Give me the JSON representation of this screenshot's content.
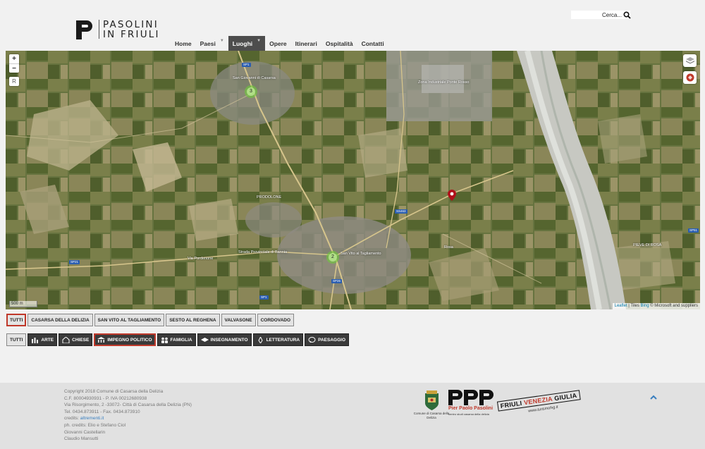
{
  "header": {
    "logo_line1": "PASOLINI",
    "logo_line2": "IN FRIULI",
    "search_placeholder": "Cerca...",
    "nav": [
      {
        "label": "Home",
        "has_caret": false,
        "active": false
      },
      {
        "label": "Paesi",
        "has_caret": true,
        "active": false
      },
      {
        "label": "Luoghi",
        "has_caret": true,
        "active": true
      },
      {
        "label": "Opere",
        "has_caret": false,
        "active": false
      },
      {
        "label": "Itinerari",
        "has_caret": false,
        "active": false
      },
      {
        "label": "Ospitalità",
        "has_caret": false,
        "active": false
      },
      {
        "label": "Contatti",
        "has_caret": false,
        "active": false
      }
    ]
  },
  "map": {
    "zoom_in": "+",
    "zoom_out": "−",
    "reset": "R",
    "clusters": [
      "3",
      "2"
    ],
    "labels": {
      "prodolone": "PRODOLONE",
      "san_giovanni": "San Giovanni di Casarsa",
      "san_vito": "San Vito al Tagliamento",
      "zona_industriale": "Zona Industriale Ponte Rosso",
      "pieve_di_rosa": "PIEVE DI ROSA",
      "via_pordenone": "Via Pordenone",
      "strada_provinciale": "Strada Provinciale di Bannia",
      "rosa": "Rosa"
    },
    "road_shields": [
      "SP1",
      "SP21",
      "SS463",
      "SP26",
      "SP1",
      "SP51"
    ],
    "scale": "500 m",
    "attribution_link": "Leaflet",
    "attribution_tiles": "| Tiles",
    "attribution_bing": "Bing",
    "attribution_rest": "© Microsoft and suppliers"
  },
  "filters_places": [
    {
      "label": "TUTTI",
      "selected": true
    },
    {
      "label": "CASARSA DELLA DELIZIA",
      "selected": false
    },
    {
      "label": "SAN VITO AL TAGLIAMENTO",
      "selected": false
    },
    {
      "label": "SESTO AL REGHENA",
      "selected": false
    },
    {
      "label": "VALVASONE",
      "selected": false
    },
    {
      "label": "CORDOVADO",
      "selected": false
    }
  ],
  "filters_categories": [
    {
      "label": "TUTTI",
      "icon": "",
      "selected": false
    },
    {
      "label": "ARTE",
      "icon": "art-icon",
      "selected": false
    },
    {
      "label": "CHIESE",
      "icon": "church-icon",
      "selected": false
    },
    {
      "label": "IMPEGNO POLITICO",
      "icon": "politics-icon",
      "selected": true
    },
    {
      "label": "FAMIGLIA",
      "icon": "family-icon",
      "selected": false
    },
    {
      "label": "INSEGNAMENTO",
      "icon": "teaching-icon",
      "selected": false
    },
    {
      "label": "LETTERATURA",
      "icon": "literature-icon",
      "selected": false
    },
    {
      "label": "PAESAGGIO",
      "icon": "landscape-icon",
      "selected": false
    }
  ],
  "footer": {
    "line1": "Copyright 2018 Comune di Casarsa della Delizia",
    "line2": "C.F. 80004930931 - P. IVA 00212680938",
    "line3": "Via Risorgimento, 2 -33072- Città di Casarsa della Delizia (PN)",
    "line4": "Tel. 0434.873911 - Fax. 0434.873910",
    "credits_label": "credits:",
    "credits_link": "altrementi.it",
    "line6": "ph. credits: Elio e Stefano Ciol",
    "line7": "Giovanni Castellarin",
    "line8": "Claudio Mansutti",
    "crest_label": "Comune di Casarsa della Delizia",
    "ppp_name": "Pier Paolo Pasolini",
    "ppp_sub": "centro studi  casarsa della delizia",
    "fvg_part1": "FRIULI ",
    "fvg_part2": "VENEZIA",
    "fvg_part3": " GIULIA",
    "fvg_url": "www.turismofvg.it"
  },
  "colors": {
    "accent_red": "#c0392b",
    "nav_active_bg": "#4d4d4d",
    "cluster_green": "#6ecc39",
    "link_blue": "#3a7fbf"
  }
}
